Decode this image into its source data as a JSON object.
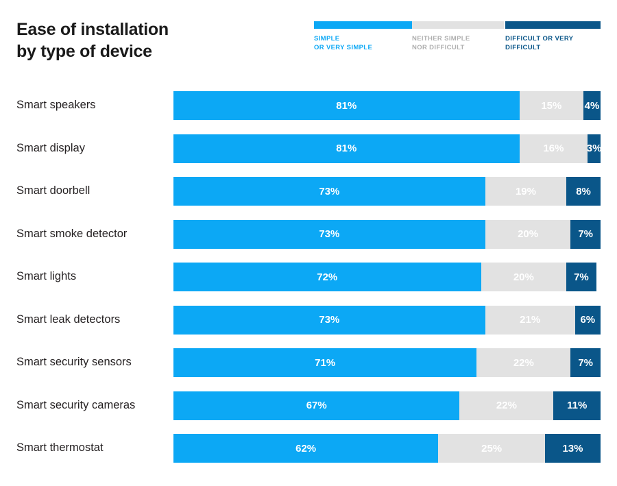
{
  "title": "Ease of installation\nby type of device",
  "colors": {
    "simple": "#0CA8F5",
    "neither": "#E2E2E2",
    "difficult": "#0A5689",
    "neither_label": "#AFAFAF",
    "text": "#231f20",
    "background": "#FFFFFF"
  },
  "legend": {
    "items": [
      {
        "label": "SIMPLE\nOR VERY SIMPLE",
        "color": "#0CA8F5"
      },
      {
        "label": "NEITHER SIMPLE\nNOR DIFFICULT",
        "color": "#E2E2E2"
      },
      {
        "label": "DIFFICULT OR VERY\nDIFFICULT",
        "color": "#0A5689"
      }
    ]
  },
  "chart_data": {
    "type": "bar",
    "subtype": "stacked-horizontal-bar",
    "title": "Ease of installation by type of device",
    "subtitle": "",
    "xlabel": "",
    "ylabel": "",
    "xlim": [
      0,
      100
    ],
    "grid": false,
    "legend_position": "top-right",
    "value_suffix": "%",
    "categories": [
      "Smart speakers",
      "Smart display",
      "Smart doorbell",
      "Smart smoke detector",
      "Smart lights",
      "Smart leak detectors",
      "Smart security sensors",
      "Smart security cameras",
      "Smart thermostat"
    ],
    "series": [
      {
        "name": "SIMPLE OR VERY SIMPLE",
        "color": "#0CA8F5",
        "values": [
          81,
          81,
          73,
          73,
          72,
          73,
          71,
          67,
          62
        ],
        "labels": [
          "81%",
          "81%",
          "73%",
          "73%",
          "72%",
          "73%",
          "71%",
          "67%",
          "62%"
        ]
      },
      {
        "name": "NEITHER SIMPLE NOR DIFFICULT",
        "color": "#E2E2E2",
        "values": [
          15,
          16,
          19,
          20,
          20,
          21,
          22,
          22,
          25
        ],
        "labels": [
          "15%",
          "16%",
          "19%",
          "20%",
          "20%",
          "21%",
          "22%",
          "22%",
          "25%"
        ]
      },
      {
        "name": "DIFFICULT OR VERY DIFFICULT",
        "color": "#0A5689",
        "values": [
          4,
          3,
          8,
          7,
          7,
          6,
          7,
          11,
          13
        ],
        "labels": [
          "4%",
          "3%",
          "8%",
          "7%",
          "7%",
          "6%",
          "7%",
          "11%",
          "13%"
        ]
      }
    ]
  }
}
